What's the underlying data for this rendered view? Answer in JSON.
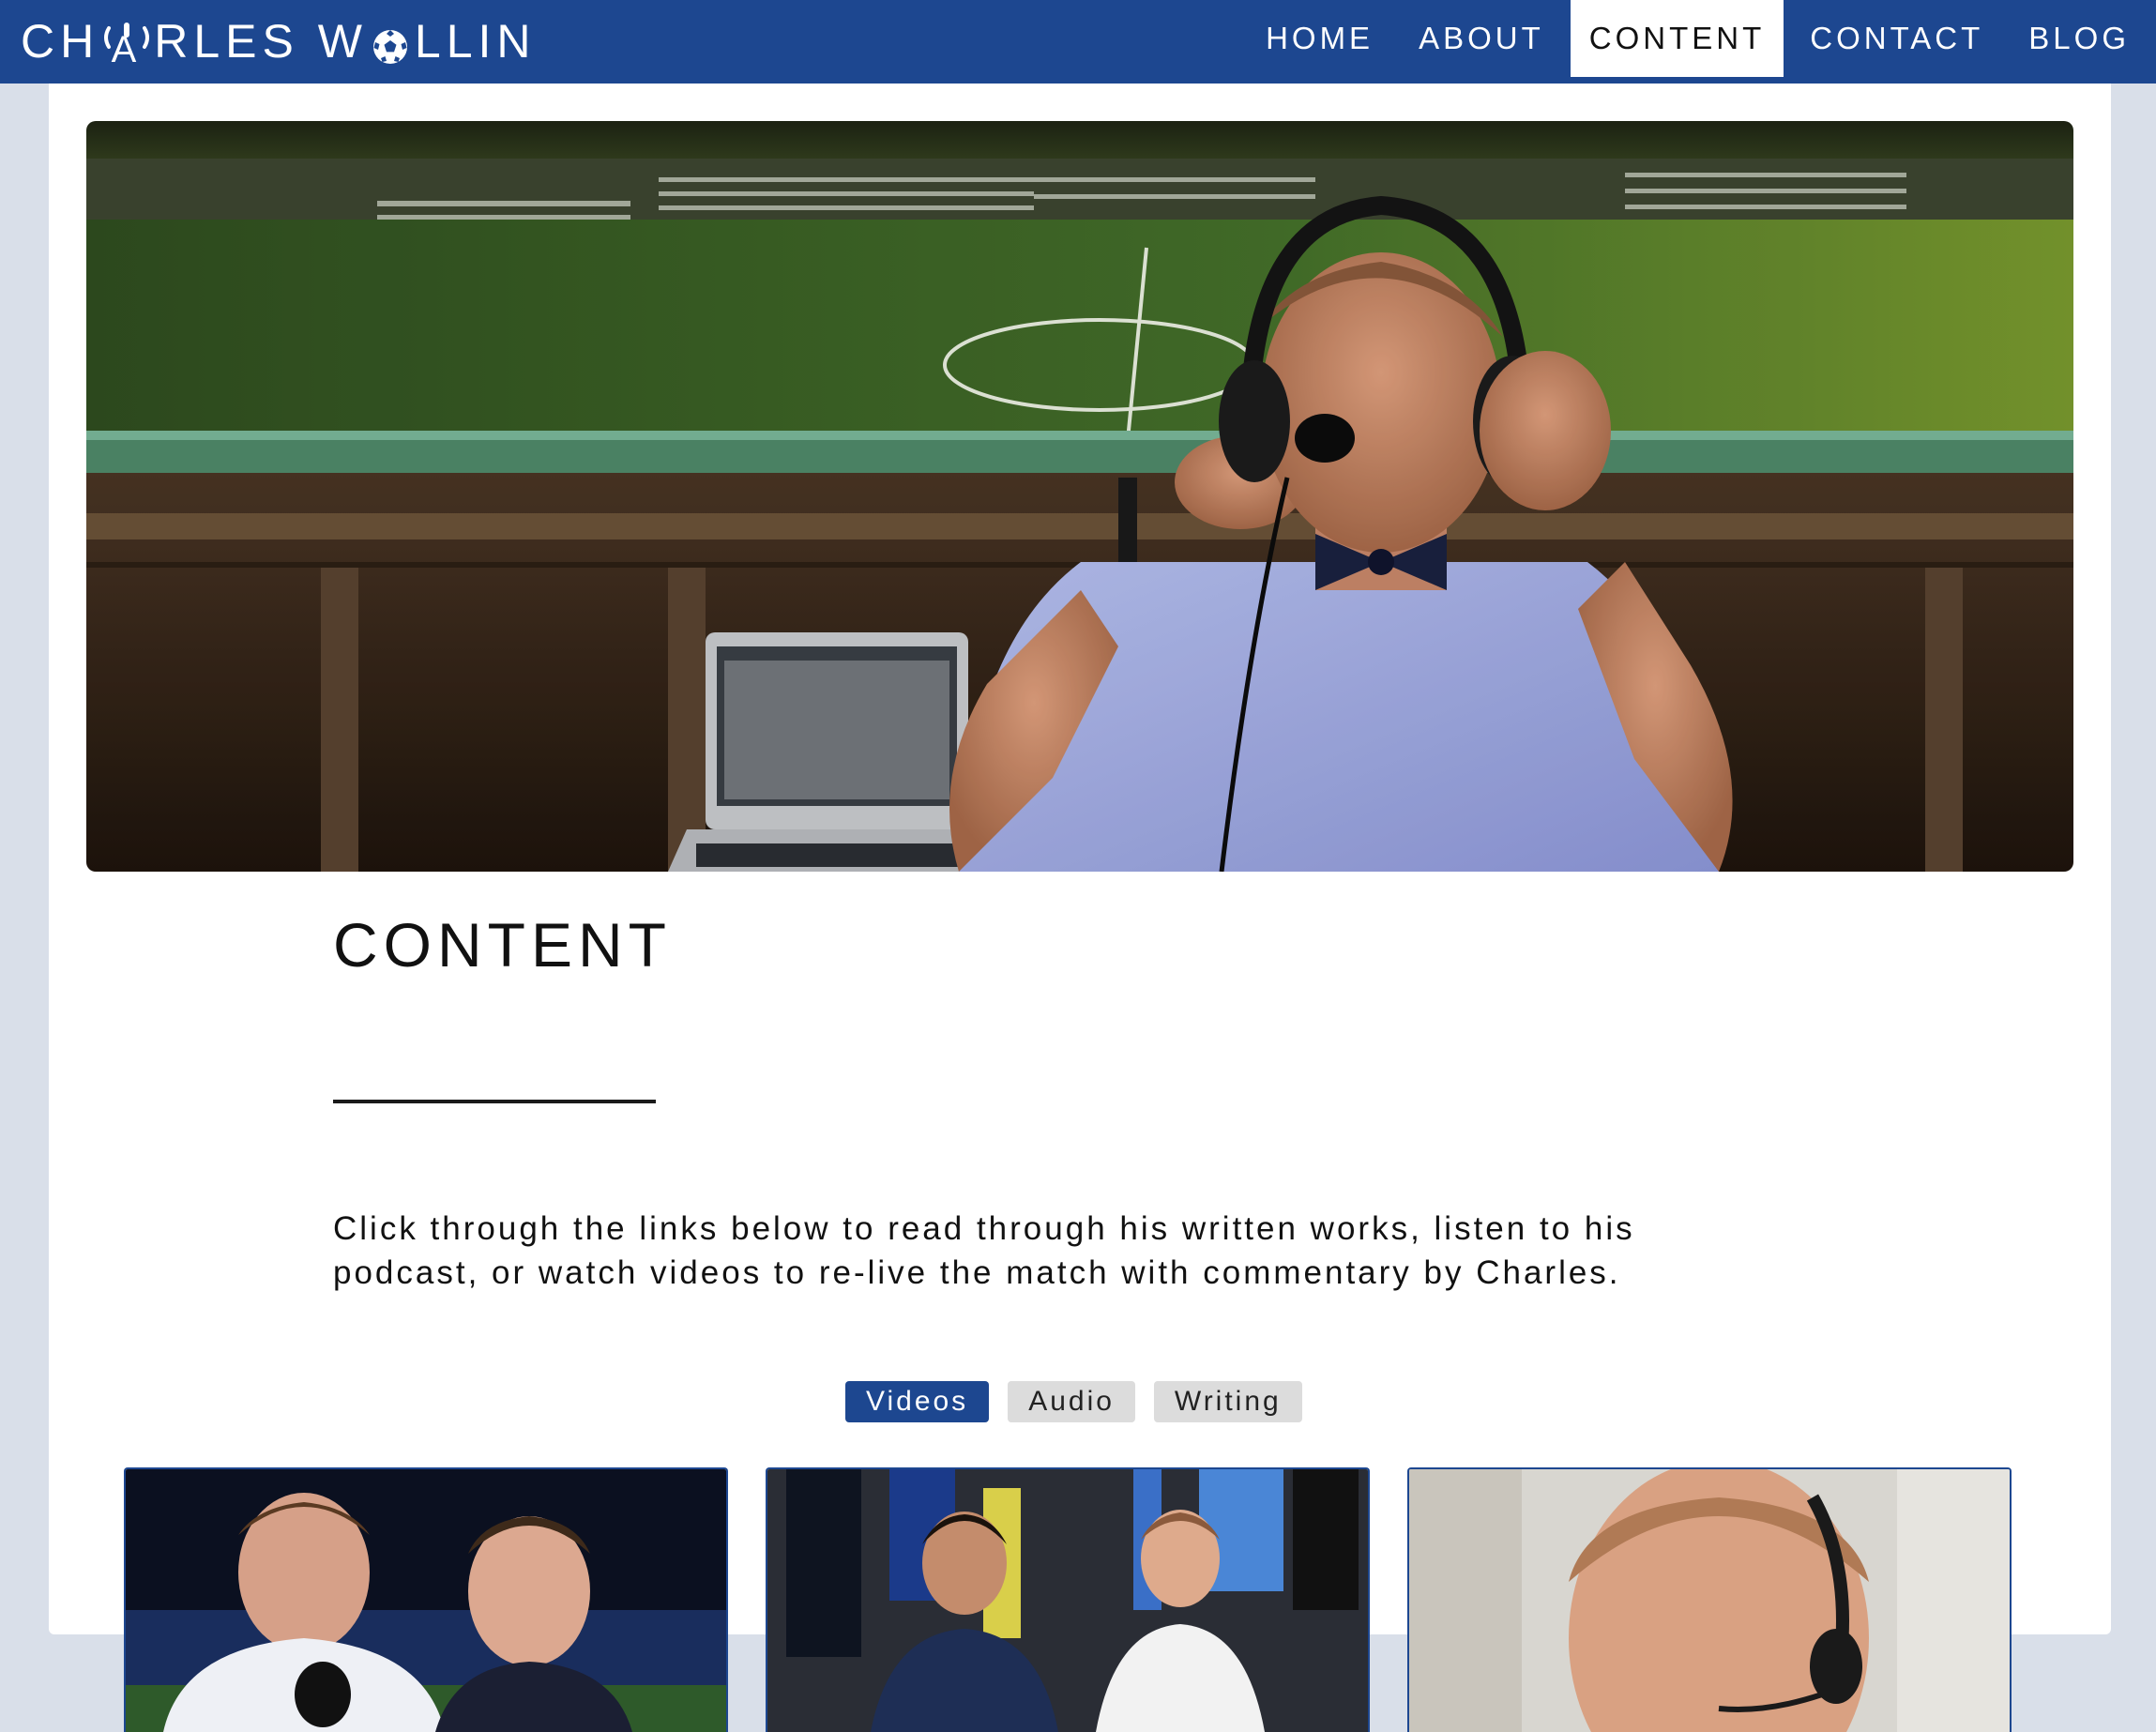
{
  "site": {
    "logo": {
      "part_1": "CH",
      "part_2": "RLES W",
      "part_3": "LLIN",
      "mic_letter": "A"
    },
    "nav": [
      {
        "label": "HOME",
        "active": false
      },
      {
        "label": "ABOUT",
        "active": false
      },
      {
        "label": "CONTENT",
        "active": true
      },
      {
        "label": "CONTACT",
        "active": false
      },
      {
        "label": "BLOG",
        "active": false
      }
    ]
  },
  "main": {
    "hero_image": "photo of commentator with headset and bow tie in a stadium press box overlooking a soccer pitch",
    "heading": "CONTENT",
    "intro": "Click through the links below to read through his written works, listen to his podcast, or watch videos to re-live the match with commentary by Charles.",
    "tabs": [
      {
        "label": "Videos",
        "active": true
      },
      {
        "label": "Audio",
        "active": false
      },
      {
        "label": "Writing",
        "active": false
      }
    ],
    "video_cards": [
      {
        "thumbnail": "postgame sideline interview at night"
      },
      {
        "thumbnail": "two hosts seated in front of soccer jerseys and scarves"
      },
      {
        "thumbnail": "commentator wearing headset microphone"
      }
    ]
  },
  "colors": {
    "brand_blue": "#1d4790",
    "page_bg": "#d9dfe9",
    "tab_inactive": "#dcdcdc"
  }
}
